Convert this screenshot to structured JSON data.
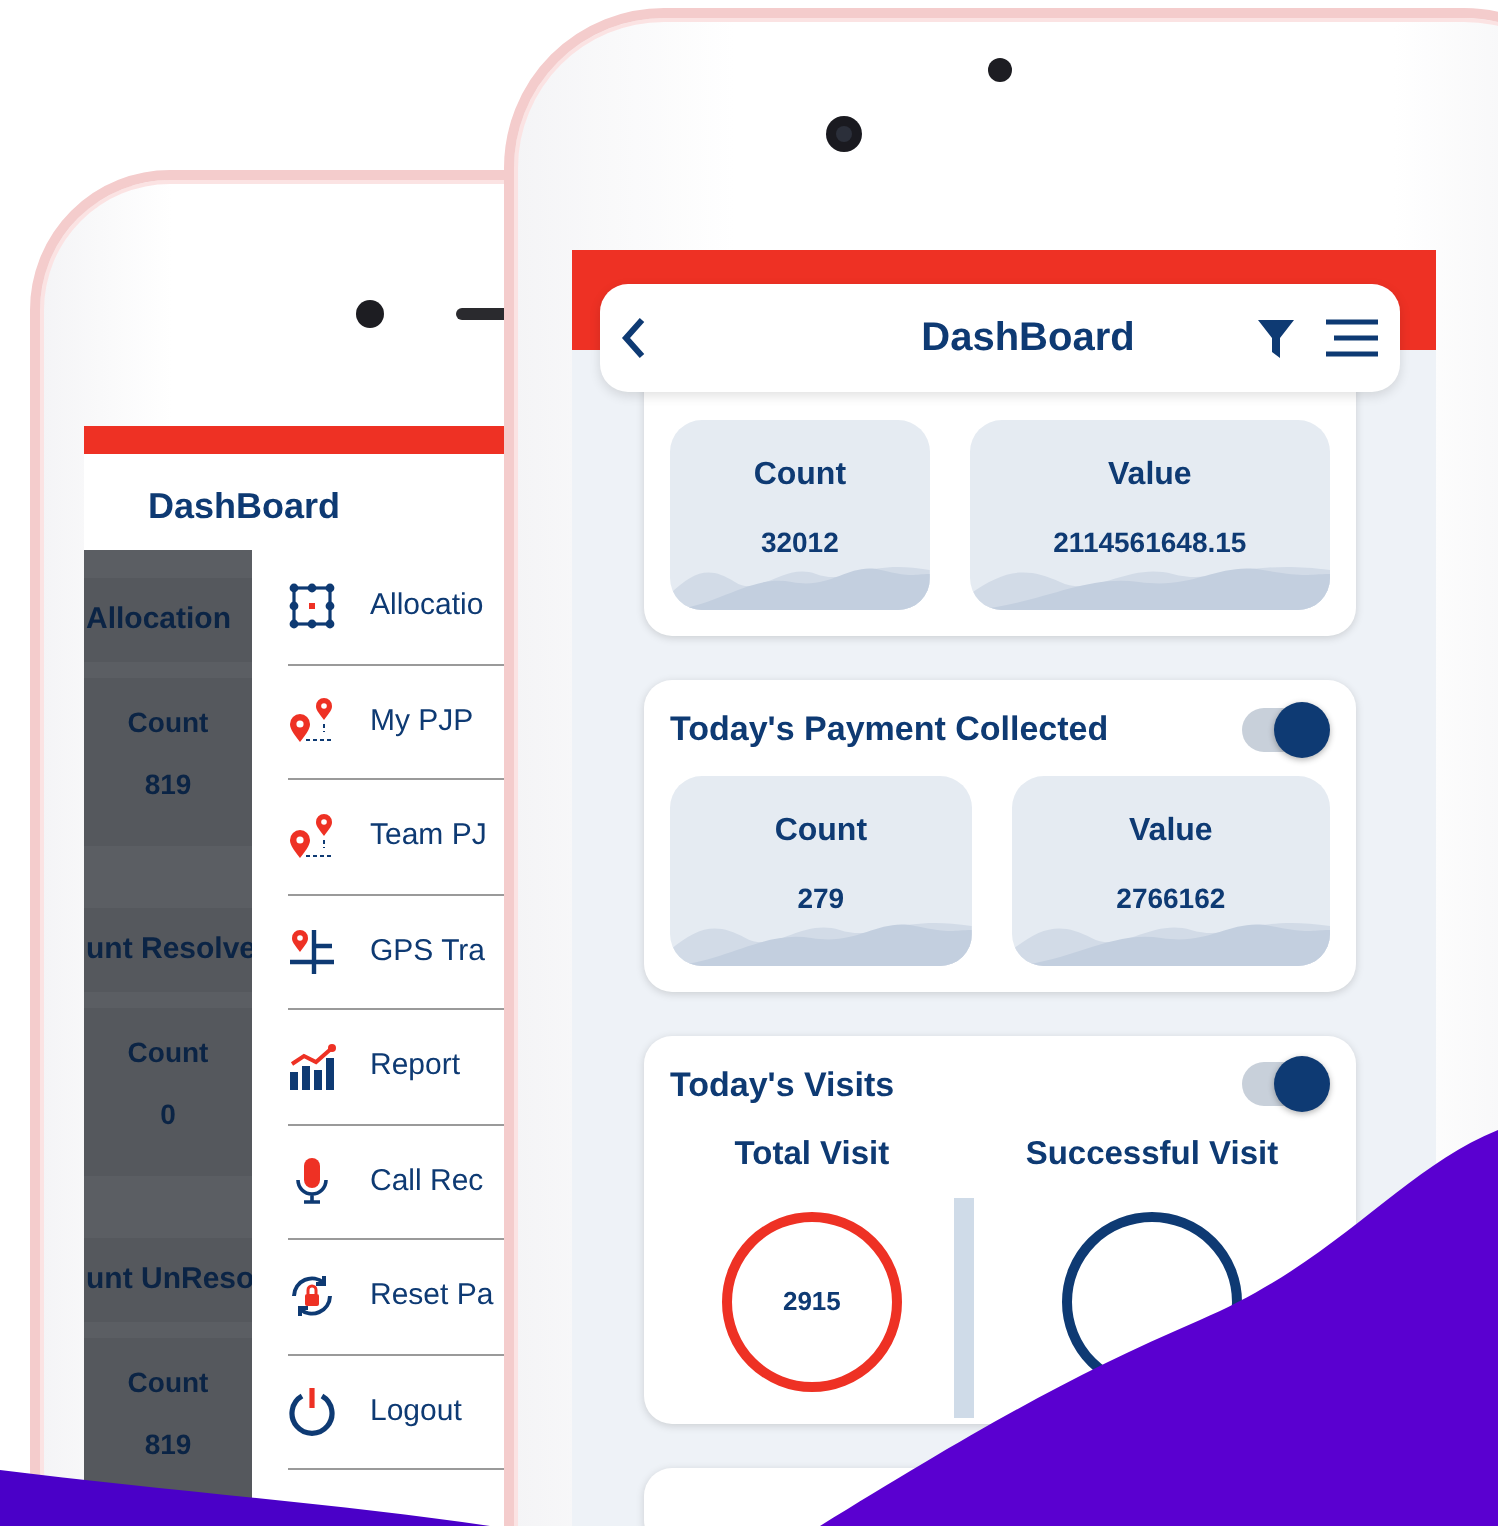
{
  "back_phone": {
    "header": {
      "title": "DashBoard"
    },
    "background_cards": [
      {
        "title": "Allocation",
        "label": "Count",
        "value": "819"
      },
      {
        "title": "unt Resolve",
        "label": "Count",
        "value": "0"
      },
      {
        "title": "unt UnReso",
        "label": "Count",
        "value": "819"
      }
    ],
    "drawer": {
      "items": [
        {
          "label": "Allocatio"
        },
        {
          "label": "My PJP"
        },
        {
          "label": "Team PJ"
        },
        {
          "label": "GPS Tra"
        },
        {
          "label": "Report"
        },
        {
          "label": "Call Rec"
        },
        {
          "label": "Reset Pa"
        },
        {
          "label": "Logout"
        }
      ]
    }
  },
  "front_phone": {
    "header": {
      "title": "DashBoard"
    },
    "cards": [
      {
        "kind": "stats",
        "stats": [
          {
            "label": "Count",
            "value": "32012"
          },
          {
            "label": "Value",
            "value": "2114561648.15"
          }
        ]
      },
      {
        "kind": "stats",
        "title": "Today's Payment Collected",
        "on": true,
        "stats": [
          {
            "label": "Count",
            "value": "279"
          },
          {
            "label": "Value",
            "value": "2766162"
          }
        ]
      },
      {
        "kind": "visits",
        "title": "Today's Visits",
        "on": true,
        "visits": [
          {
            "label": "Total Visit",
            "value": "2915"
          },
          {
            "label": "Successful Visit"
          }
        ]
      }
    ]
  }
}
